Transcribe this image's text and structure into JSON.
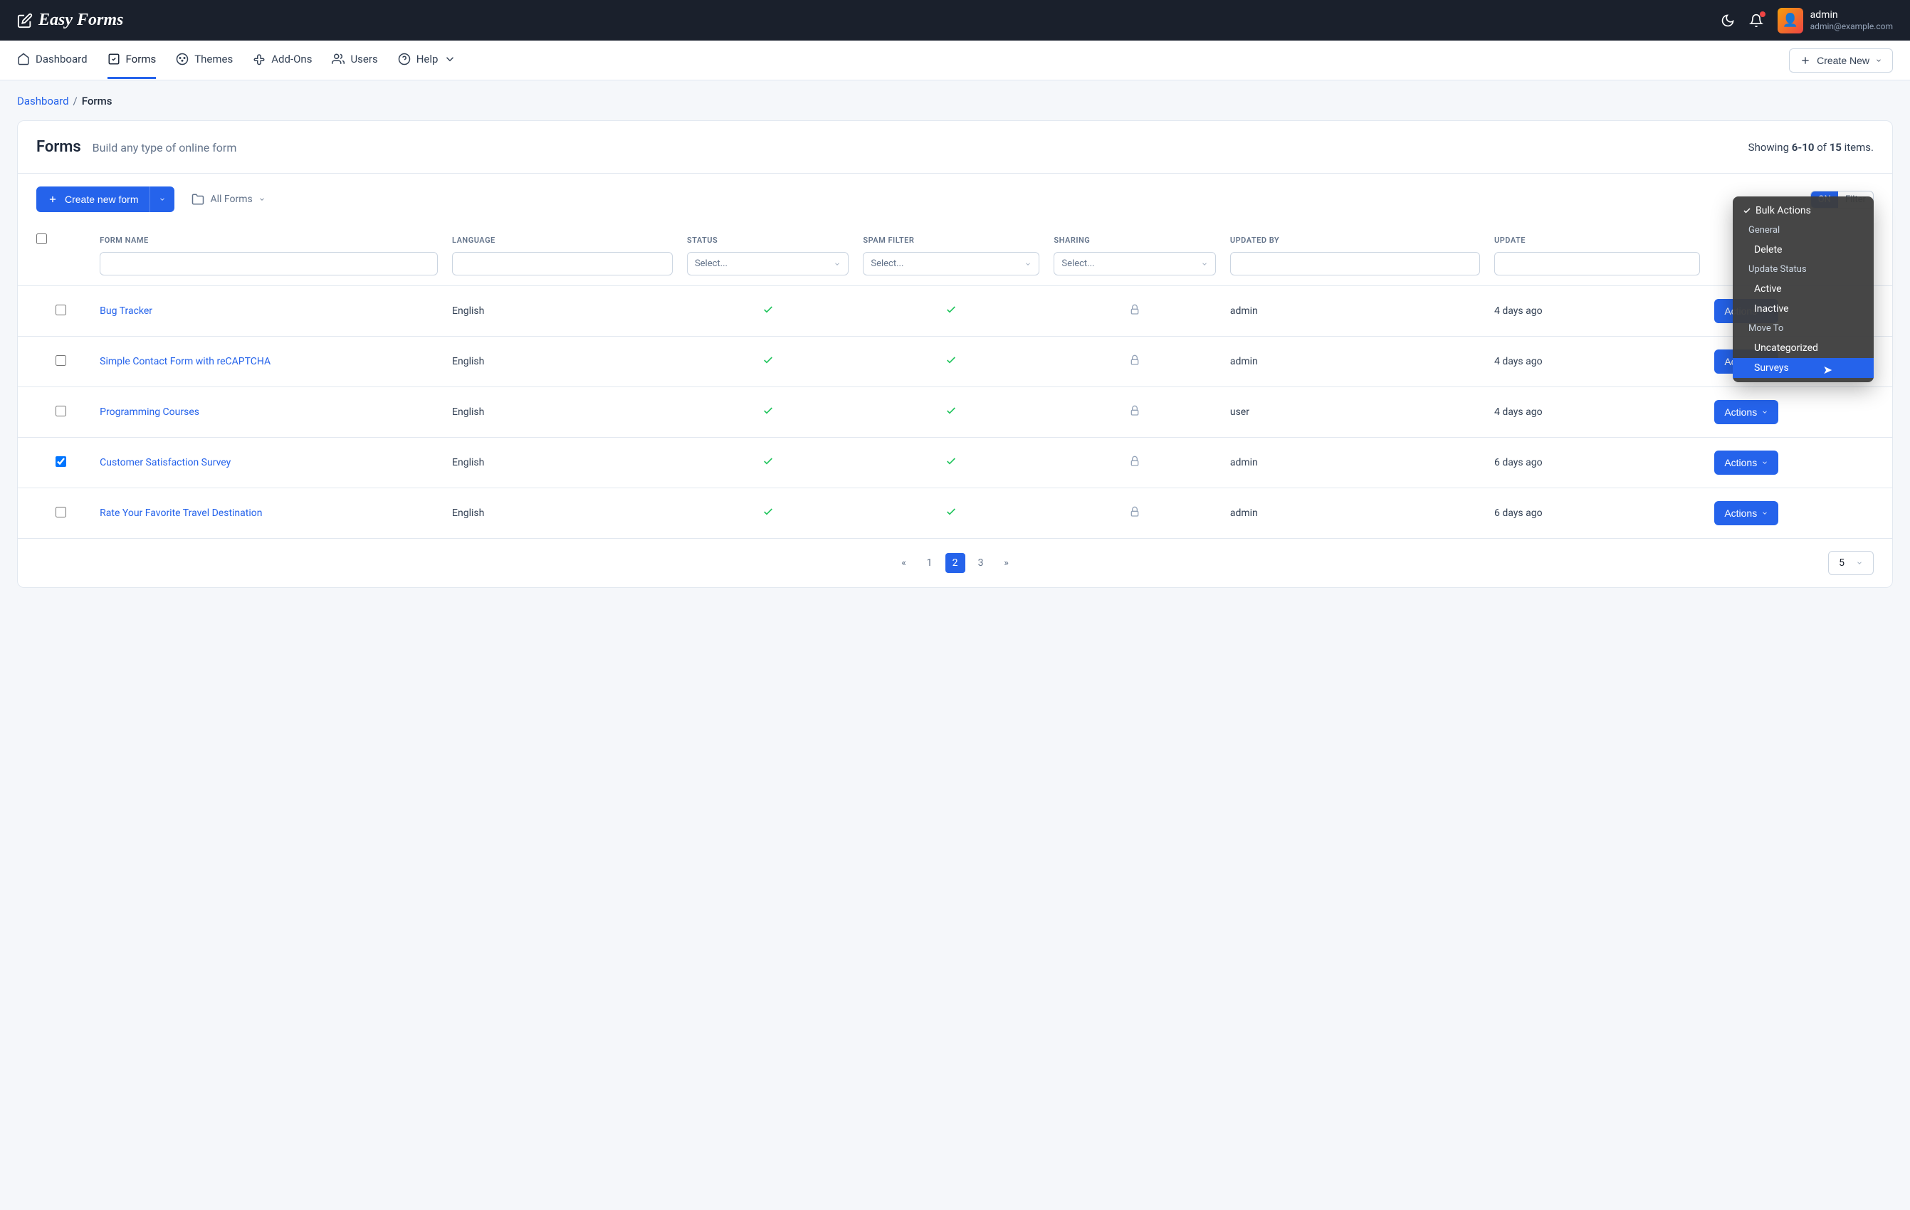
{
  "app_name": "Easy Forms",
  "user": {
    "name": "admin",
    "email": "admin@example.com"
  },
  "nav": {
    "dashboard": "Dashboard",
    "forms": "Forms",
    "themes": "Themes",
    "addons": "Add-Ons",
    "users": "Users",
    "help": "Help",
    "create_new": "Create New"
  },
  "breadcrumb": {
    "dashboard": "Dashboard",
    "current": "Forms"
  },
  "page": {
    "title": "Forms",
    "subtitle": "Build any type of online form",
    "showing_prefix": "Showing ",
    "showing_range": "6-10",
    "showing_mid": " of ",
    "showing_total": "15",
    "showing_suffix": " items."
  },
  "toolbar": {
    "create_label": "Create new form",
    "all_forms": "All Forms",
    "filter_on": "ON",
    "filter_label": "Filter"
  },
  "bulk": {
    "header": "Bulk Actions",
    "group_general": "General",
    "delete": "Delete",
    "group_update": "Update Status",
    "active": "Active",
    "inactive": "Inactive",
    "group_move": "Move To",
    "uncategorized": "Uncategorized",
    "surveys": "Surveys"
  },
  "columns": {
    "form_name": "FORM NAME",
    "language": "LANGUAGE",
    "status": "STATUS",
    "spam_filter": "SPAM FILTER",
    "sharing": "SHARING",
    "updated_by": "UPDATED BY",
    "updated": "UPDATE"
  },
  "filter_placeholder": "Select...",
  "rows": [
    {
      "checked": false,
      "name": "Bug Tracker",
      "language": "English",
      "status": true,
      "spam": true,
      "sharing_locked": true,
      "updated_by": "admin",
      "updated": "4 days ago",
      "actions": "Actions"
    },
    {
      "checked": false,
      "name": "Simple Contact Form with reCAPTCHA",
      "language": "English",
      "status": true,
      "spam": true,
      "sharing_locked": true,
      "updated_by": "admin",
      "updated": "4 days ago",
      "actions": "Actions"
    },
    {
      "checked": false,
      "name": "Programming Courses",
      "language": "English",
      "status": true,
      "spam": true,
      "sharing_locked": true,
      "updated_by": "user",
      "updated": "4 days ago",
      "actions": "Actions"
    },
    {
      "checked": true,
      "name": "Customer Satisfaction Survey",
      "language": "English",
      "status": true,
      "spam": true,
      "sharing_locked": true,
      "updated_by": "admin",
      "updated": "6 days ago",
      "actions": "Actions"
    },
    {
      "checked": false,
      "name": "Rate Your Favorite Travel Destination",
      "language": "English",
      "status": true,
      "spam": true,
      "sharing_locked": true,
      "updated_by": "admin",
      "updated": "6 days ago",
      "actions": "Actions"
    }
  ],
  "pagination": {
    "prev": "«",
    "p1": "1",
    "p2": "2",
    "p3": "3",
    "next": "»",
    "page_size": "5"
  }
}
